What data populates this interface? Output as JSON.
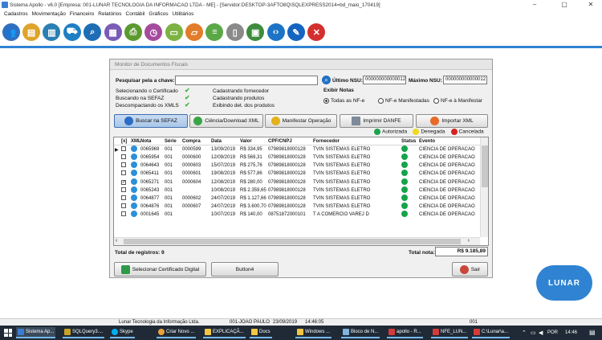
{
  "window": {
    "title": "Sistema Apollo - v6.0 [Empresa: 001-LUNAR TECNOLOGIA DA INFORMACAO LTDA - ME] - [Servidor:DESKTOP-3AFTO8Q\\SQLEXPRESS2014=bd_maio_170419]",
    "minimize": "–",
    "maximize": "▢",
    "close": "✕"
  },
  "menu": [
    "Cadastros",
    "Movimentação",
    "Financeiro",
    "Relatórios",
    "Contábil",
    "Gráficos",
    "Utilitários"
  ],
  "toolbar": [
    {
      "icon": "users-icon",
      "color": "#2f6fc0",
      "glyph": "👥"
    },
    {
      "icon": "cash-register-icon",
      "color": "#e0a32a",
      "glyph": "▤"
    },
    {
      "icon": "products-icon",
      "color": "#2a7fb3",
      "glyph": "▥"
    },
    {
      "icon": "cart-icon",
      "color": "#1f7fc4",
      "glyph": "⛟"
    },
    {
      "icon": "search-icon",
      "color": "#1e6db5",
      "glyph": "⌕"
    },
    {
      "icon": "monitor-icon",
      "color": "#7a5bb5",
      "glyph": "▦"
    },
    {
      "icon": "printer-icon",
      "color": "#5b9a2e",
      "glyph": "⎙"
    },
    {
      "icon": "clock-icon",
      "color": "#a64a9e",
      "glyph": "◷"
    },
    {
      "icon": "folder-icon",
      "color": "#7cb342",
      "glyph": "▭"
    },
    {
      "icon": "folder-open-icon",
      "color": "#e27c2a",
      "glyph": "▱"
    },
    {
      "icon": "database-icon",
      "color": "#5aa846",
      "glyph": "≡"
    },
    {
      "icon": "document-icon",
      "color": "#8a8a8a",
      "glyph": "▯"
    },
    {
      "icon": "calculator-icon",
      "color": "#3d8c3d",
      "glyph": "▣"
    },
    {
      "icon": "code-icon",
      "color": "#1d74c6",
      "glyph": "‹›"
    },
    {
      "icon": "settings-icon",
      "color": "#1565c0",
      "glyph": "✎"
    },
    {
      "icon": "close-icon",
      "color": "#d32f2f",
      "glyph": "✕"
    }
  ],
  "dialog": {
    "title": "Monitor de Documentos Fiscais",
    "search_label": "Pesquisar pela a chave:",
    "search_value": "",
    "ultimo_nsu_label": "Último NSU:",
    "ultimo_nsu_value": "000000000000012",
    "maximo_nsu_label": "Máximo NSU:",
    "maximo_nsu_value": "000000000000012",
    "status_left": [
      "Selecionando o Certificado",
      "Buscando na SEFAZ",
      "Descompactando os XMLS"
    ],
    "status_right": [
      "Cadastrando fornecedor",
      "Cadastrando produtos",
      "Exibindo det. dos produtos"
    ],
    "exibir_title": "Exibir Notas",
    "radios": [
      {
        "label": "Todas as NF-e",
        "checked": true
      },
      {
        "label": "NF-e Manifestadas",
        "checked": false
      },
      {
        "label": "NF-e à Manifestar",
        "checked": false
      }
    ],
    "buttons": {
      "buscar": "Buscar na SEFAZ",
      "ciencia": "Ciência/Download XML",
      "manifestar": "Manifestar Operação",
      "imprimir": "Imprimir DANFE",
      "importar": "Importar XML"
    },
    "legend": [
      {
        "label": "Autorizada",
        "color": "#1aa34a"
      },
      {
        "label": "Denegada",
        "color": "#f0d91c"
      },
      {
        "label": "Cancelada",
        "color": "#d6221e"
      }
    ],
    "columns": [
      "[x]",
      "XML",
      "Nota",
      "Série",
      "Compra",
      "Data",
      "Valor",
      "CPF/CNPJ",
      "Fornecedor",
      "Status",
      "Evento"
    ],
    "rows": [
      {
        "current": true,
        "checked": false,
        "nota": "0065969",
        "serie": "001",
        "compra": "0000599",
        "data": "13/09/2019",
        "valor": "R$ 334,95",
        "cnpj": "07989818000128",
        "fornecedor": "TVIN SISTEMAS ELETRO",
        "evento": "CIENCIA DE OPERACAO"
      },
      {
        "current": false,
        "checked": false,
        "nota": "0065954",
        "serie": "001",
        "compra": "0000600",
        "data": "12/09/2019",
        "valor": "R$ 569,31",
        "cnpj": "07989818000128",
        "fornecedor": "TVIN SISTEMAS ELETRO",
        "evento": "CIENCIA DE OPERACAO"
      },
      {
        "current": false,
        "checked": false,
        "nota": "0064643",
        "serie": "001",
        "compra": "0000603",
        "data": "15/07/2019",
        "valor": "R$ 275,76",
        "cnpj": "07989818000128",
        "fornecedor": "TVIN SISTEMAS ELETRO",
        "evento": "CIENCIA DE OPERACAO"
      },
      {
        "current": false,
        "checked": false,
        "nota": "0065411",
        "serie": "001",
        "compra": "0000601",
        "data": "19/08/2019",
        "valor": "R$ 577,86",
        "cnpj": "07989818000128",
        "fornecedor": "TVIN SISTEMAS ELETRO",
        "evento": "CIENCIA DE OPERACAO"
      },
      {
        "current": false,
        "checked": true,
        "nota": "0065271",
        "serie": "001",
        "compra": "0000604",
        "data": "12/08/2019",
        "valor": "R$ 280,00",
        "cnpj": "07989818000128",
        "fornecedor": "TVIN SISTEMAS ELETRO",
        "evento": "CIENCIA DE OPERACAO"
      },
      {
        "current": false,
        "checked": false,
        "nota": "0065243",
        "serie": "001",
        "compra": "",
        "data": "10/08/2019",
        "valor": "R$ 2.359,65",
        "cnpj": "07989818000128",
        "fornecedor": "TVIN SISTEMAS ELETRO",
        "evento": "CIENCIA DE OPERACAO"
      },
      {
        "current": false,
        "checked": false,
        "nota": "0064877",
        "serie": "001",
        "compra": "0000602",
        "data": "24/07/2019",
        "valor": "R$ 1.127,66",
        "cnpj": "07989818000128",
        "fornecedor": "TVIN SISTEMAS ELETRO",
        "evento": "CIENCIA DE OPERACAO"
      },
      {
        "current": false,
        "checked": false,
        "nota": "0064876",
        "serie": "001",
        "compra": "0000607",
        "data": "24/07/2019",
        "valor": "R$ 3.600,70",
        "cnpj": "07989818000128",
        "fornecedor": "TVIN SISTEMAS ELETRO",
        "evento": "CIENCIA DE OPERACAO"
      },
      {
        "current": false,
        "checked": false,
        "nota": "0001645",
        "serie": "001",
        "compra": "",
        "data": "10/07/2019",
        "valor": "R$ 140,00",
        "cnpj": "08751872000101",
        "fornecedor": "T A COMERCIO VAREJ D",
        "evento": "CIENCIA DE OPERACAO"
      }
    ],
    "total_registros": "Total de registros: 9",
    "total_nota_label": "Total nota:",
    "total_nota_value": "R$ 9.185,89",
    "selecionar_cert": "Selecionar Certificado Digital",
    "button4": "Button4",
    "sair": "Sair"
  },
  "brand": "LUNAR",
  "statusbar": {
    "company": "Lunar Tecnologia da Informação Ltda.",
    "user": "001-JOAO PAULO",
    "date": "23/09/2019",
    "time": "14:46:05",
    "code": "001"
  },
  "taskbar": {
    "items": [
      "Sistema Ap...",
      "SQLQuery3....",
      "Skype",
      "Criar Novo ...",
      "EXPLICAÇÃ...",
      "Docs",
      "Windows ...",
      "Bloco de N...",
      "apollo - R...",
      "NFE_LUN...",
      "C:\\Lunar\\a..."
    ],
    "lang": "POR",
    "clock": "14:46"
  }
}
